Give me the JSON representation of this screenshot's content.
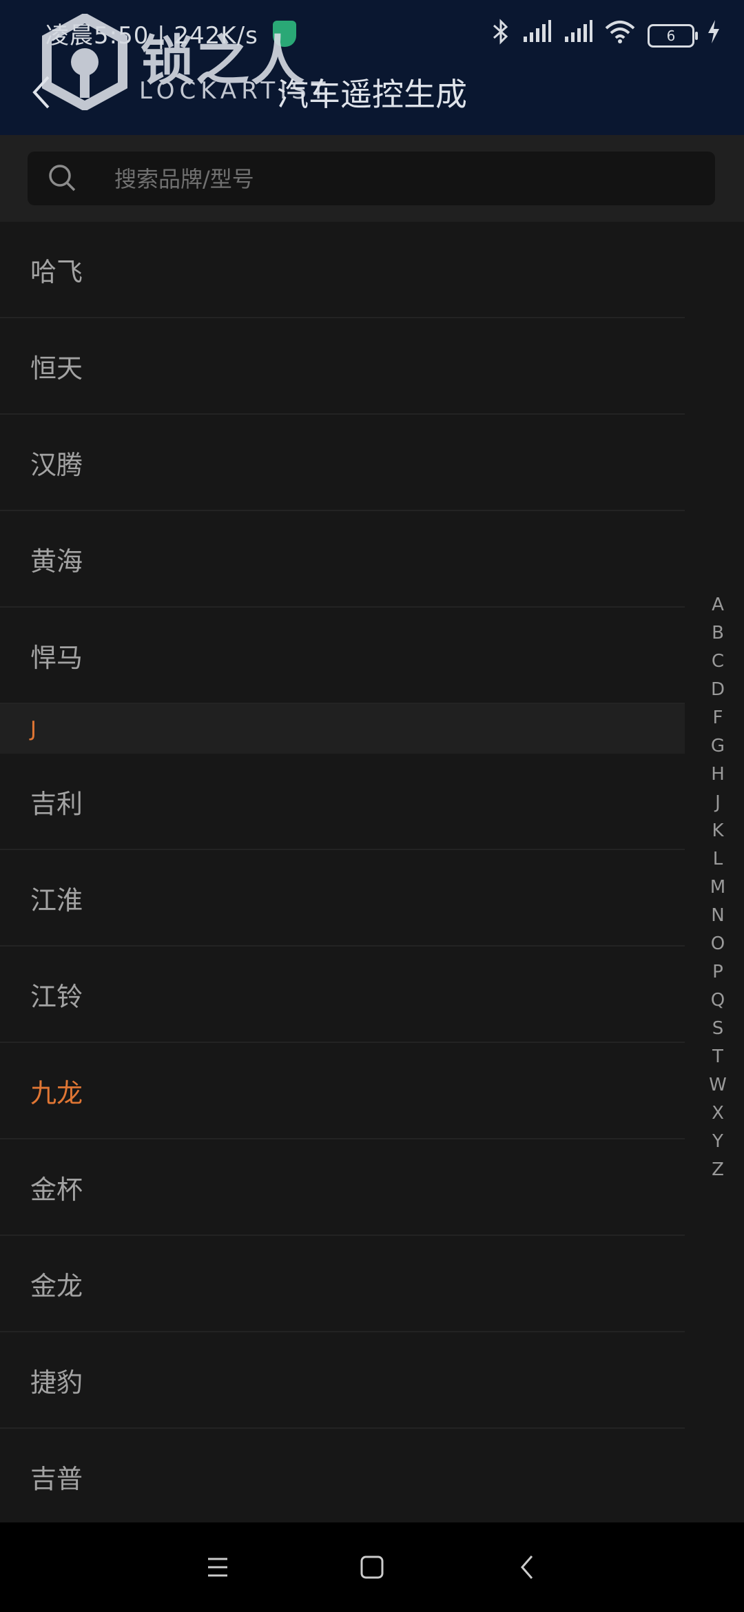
{
  "status": {
    "time": "凌晨5:50 | 242K/s",
    "battery": "6"
  },
  "logo": {
    "cn": "锁之人",
    "en": "LOCKARTIST"
  },
  "header": {
    "title": "汽车遥控生成"
  },
  "search": {
    "placeholder": "搜索品牌/型号"
  },
  "list": {
    "items_top": [
      "哈飞",
      "恒天",
      "汉腾",
      "黄海",
      "悍马"
    ],
    "section": "J",
    "items_j": [
      "吉利",
      "江淮",
      "江铃",
      "九龙",
      "金杯",
      "金龙",
      "捷豹",
      "吉普"
    ],
    "active": "九龙"
  },
  "index_letters": [
    "A",
    "B",
    "C",
    "D",
    "F",
    "G",
    "H",
    "J",
    "K",
    "L",
    "M",
    "N",
    "O",
    "P",
    "Q",
    "S",
    "T",
    "W",
    "X",
    "Y",
    "Z"
  ],
  "icons": {
    "back": "back-arrow-icon",
    "search": "search-icon",
    "bluetooth": "bluetooth-icon",
    "signal": "signal-icon",
    "wifi": "wifi-icon",
    "charging": "charging-icon",
    "menu": "menu-icon",
    "home": "home-icon",
    "nav_back": "nav-back-icon"
  },
  "colors": {
    "header": "#0a1730",
    "accent": "#e07634",
    "background": "#171717"
  }
}
